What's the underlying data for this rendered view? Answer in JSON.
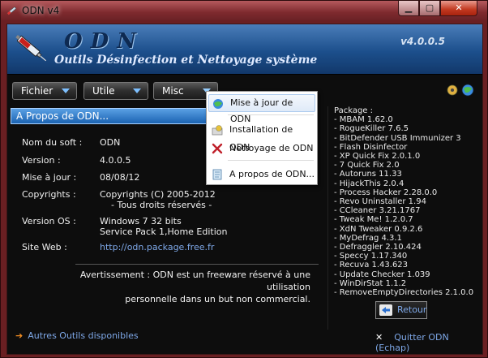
{
  "window": {
    "title": "ODN v4"
  },
  "banner": {
    "logo": "ODN",
    "subtitle": "Outils Désinfection et Nettoyage système",
    "version": "v4.0.0.5"
  },
  "menu": {
    "fichier": "Fichier",
    "utile": "Utile",
    "misc": "Misc"
  },
  "dropdown": {
    "items": [
      {
        "label": "Mise à jour de ODN",
        "icon": "globe-update-icon"
      },
      {
        "label": "Installation de ODN",
        "icon": "install-icon"
      },
      {
        "label": "Nettoyage de ODN",
        "icon": "red-x-icon"
      },
      {
        "label": "A propos de ODN...",
        "icon": "document-icon"
      }
    ]
  },
  "about": {
    "header": "A Propos de ODN...",
    "rows": [
      {
        "label": "Nom du soft :",
        "value": "ODN"
      },
      {
        "label": "Version :",
        "value": "4.0.0.5"
      },
      {
        "label": "Mise à jour :",
        "value": "08/08/12"
      },
      {
        "label": "Copyrights :",
        "value": "Copyrights (C) 2005-2012",
        "value2": "- Tous droits réservés -"
      },
      {
        "label": "Version OS :",
        "value": "Windows 7 32 bits",
        "value2": "Service Pack 1,Home Edition"
      },
      {
        "label": "Site Web :",
        "value": "http://odn.package.free.fr"
      }
    ],
    "warning_line1": "Avertissement : ODN est un freeware réservé à une utilisation",
    "warning_line2": "personnelle dans un but non commercial."
  },
  "package": {
    "title": "Package :",
    "items": [
      "- MBAM 1.62.0",
      "- RogueKiller 7.6.5",
      "- BitDefender USB Immunizer 3",
      "- Flash Disinfector",
      "- XP Quick Fix 2.0.1.0",
      "- 7 Quick Fix 2.0",
      "- Autoruns 11.33",
      "- HijackThis 2.0.4",
      "- Process Hacker 2.28.0.0",
      "- Revo Uninstaller 1.94",
      "- CCleaner 3.21.1767",
      "- Tweak Me! 1.2.0.7",
      "- XdN Tweaker 0.9.2.6",
      "- MyDefrag 4.3.1",
      "- Defraggler 2.10.424",
      "- Speccy 1.17.340",
      "- Recuva 1.43.623",
      "- Update Checker 1.039",
      "- WinDirStat 1.1.2",
      "- RemoveEmptyDirectories 2.1.0.0"
    ]
  },
  "buttons": {
    "retour": "Retour",
    "quit": "Quitter ODN (Echap)",
    "other_tools": "Autres Outils disponibles"
  }
}
